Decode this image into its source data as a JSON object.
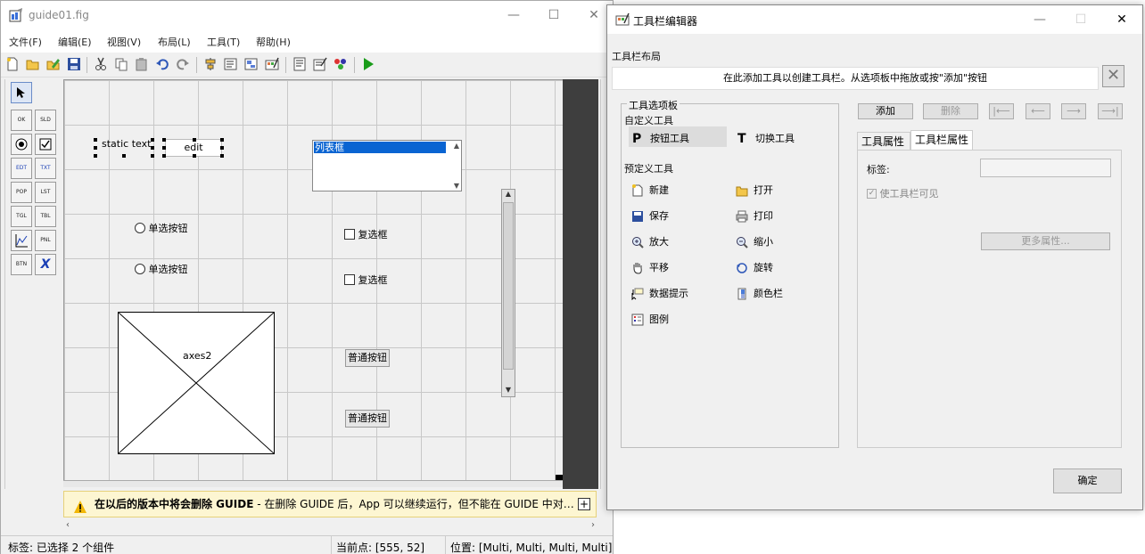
{
  "guide": {
    "title": "guide01.fig",
    "menu": [
      "文件(F)",
      "编辑(E)",
      "视图(V)",
      "布局(L)",
      "工具(T)",
      "帮助(H)"
    ],
    "palette": [
      "OK",
      "SLD",
      "RB",
      "CB",
      "EDT",
      "TXT",
      "POP",
      "LST",
      "TGL",
      "TBL",
      "AX",
      "PNL",
      "BTN",
      "X"
    ],
    "components": {
      "static_text": "static text",
      "edit": "edit",
      "listbox_item": "列表框",
      "radio1": "单选按钮",
      "radio2": "单选按钮",
      "check1": "复选框",
      "check2": "复选框",
      "axes": "axes2",
      "push1": "普通按钮",
      "push2": "普通按钮"
    },
    "warning": {
      "bold": "在以后的版本中将会删除 GUIDE",
      "rest": " - 在删除 GUIDE 后，App 可以继续运行，但不能在 GUIDE 中对…"
    },
    "status": {
      "label": "标签: 已选择 2 个组件",
      "point": "当前点:  [555, 52]",
      "position": "位置: [Multi, Multi, Multi, Multi]"
    }
  },
  "editor": {
    "title": "工具栏编辑器",
    "layout_label": "工具栏布局",
    "hint": "在此添加工具以创建工具栏。从选项板中拖放或按\"添加\"按钮",
    "palette_title": "工具选项板",
    "custom_title": "自定义工具",
    "custom_tools": [
      "按钮工具",
      "切换工具"
    ],
    "predefined_title": "预定义工具",
    "predefined_tools": [
      "新建",
      "打开",
      "保存",
      "打印",
      "放大",
      "缩小",
      "平移",
      "旋转",
      "数据提示",
      "颜色栏",
      "图例"
    ],
    "add_label": "添加",
    "delete_label": "删除",
    "tabs": [
      "工具属性",
      "工具栏属性"
    ],
    "tag_label": "标签:",
    "tag_value": "",
    "visible_label": "使工具栏可见",
    "more_props": "更多属性...",
    "ok_label": "确定"
  },
  "colors": {
    "accent": "#0a64d2",
    "warn_bg": "#fdf6d2",
    "run_green": "#1a9c1a"
  }
}
